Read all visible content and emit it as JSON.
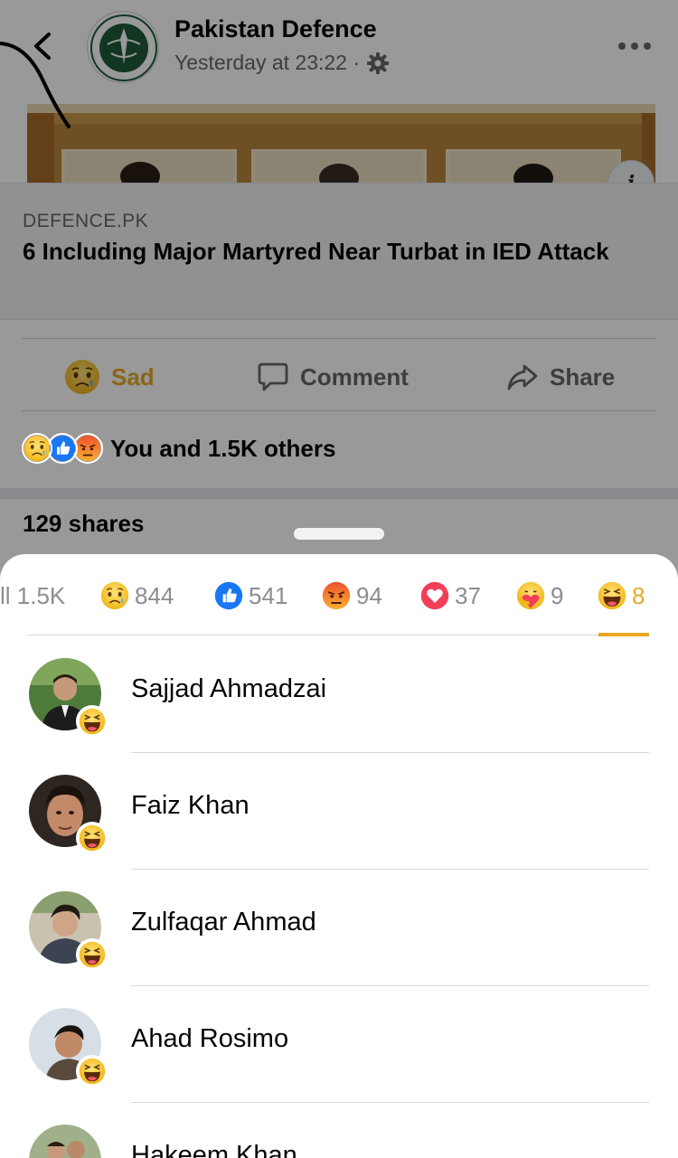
{
  "post": {
    "page_name": "Pakistan Defence",
    "timestamp": "Yesterday at 23:22 ·",
    "link": {
      "domain": "DEFENCE.PK",
      "title": "6 Including Major Martyred Near Turbat in IED Attack"
    },
    "actions": {
      "sad": "Sad",
      "comment": "Comment",
      "share": "Share"
    },
    "reaction_summary": "You and 1.5K others",
    "shares": "129 shares"
  },
  "sheet": {
    "tabs": [
      {
        "label": "ll 1.5K",
        "icon": "all"
      },
      {
        "label": "844",
        "icon": "sad-icon"
      },
      {
        "label": "541",
        "icon": "like-icon"
      },
      {
        "label": "94",
        "icon": "angry-icon"
      },
      {
        "label": "37",
        "icon": "love-icon"
      },
      {
        "label": "9",
        "icon": "care-icon"
      },
      {
        "label": "8",
        "icon": "haha-icon"
      }
    ],
    "active_tab": 6,
    "people": [
      {
        "name": "Sajjad Ahmadzai",
        "reaction": "haha-icon"
      },
      {
        "name": "Faiz Khan",
        "reaction": "haha-icon"
      },
      {
        "name": "Zulfaqar Ahmad",
        "reaction": "haha-icon"
      },
      {
        "name": "Ahad Rosimo",
        "reaction": "haha-icon"
      },
      {
        "name": "Hakeem Khan",
        "reaction": "haha-icon"
      }
    ]
  },
  "colors": {
    "accent": "#e7a825",
    "like_blue": "#1877f2",
    "love_red": "#f33e58",
    "angry_orange": "#e9710f"
  }
}
